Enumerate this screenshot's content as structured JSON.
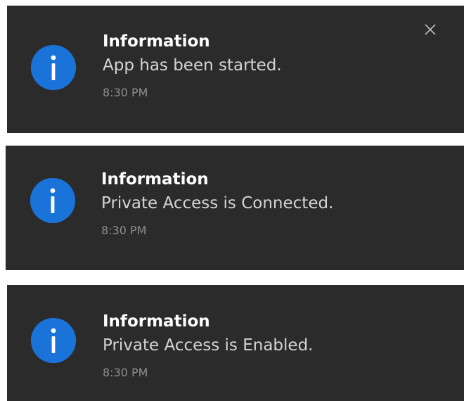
{
  "colors": {
    "toast_background": "#2b2b2b",
    "icon_blue": "#1a73d9",
    "title_text": "#ffffff",
    "message_text": "#d4d4d4",
    "time_text": "#8f8f8f"
  },
  "notifications": [
    {
      "icon": "info-icon",
      "title": "Information",
      "message": "App has been started.",
      "time": "8:30 PM",
      "close_icon": "close-icon"
    },
    {
      "icon": "info-icon",
      "title": "Information",
      "message": "Private Access is Connected.",
      "time": "8:30 PM"
    },
    {
      "icon": "info-icon",
      "title": "Information",
      "message": "Private Access is Enabled.",
      "time": "8:30 PM"
    }
  ]
}
